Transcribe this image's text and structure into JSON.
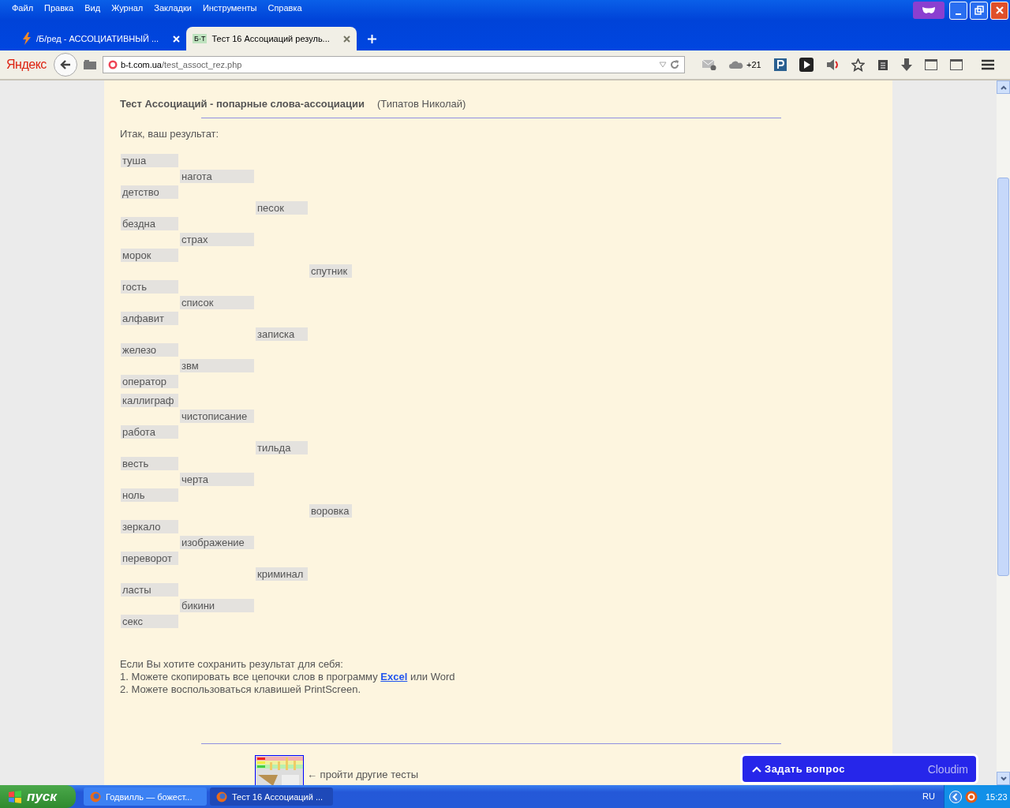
{
  "menu": [
    "Файл",
    "Правка",
    "Вид",
    "Журнал",
    "Закладки",
    "Инструменты",
    "Справка"
  ],
  "tabs": [
    {
      "title": "/Б/ред - АССОЦИАТИВНЫЙ ...",
      "selected": false
    },
    {
      "title": "Тест 16 Ассоциаций резуль...",
      "selected": true,
      "favicon_text": "Б·Т"
    }
  ],
  "navbar": {
    "logo": "Яндекс",
    "url_host": "b-t.com.ua",
    "url_path": "/test_assoct_rez.php",
    "cloud_count": "+21"
  },
  "page": {
    "title": "Тест Ассоциаций - попарные слова-ассоциации",
    "author": "(Типатов Николай)",
    "intro": "Итак, ваш результат:",
    "rows": [
      {
        "column_1": "туша"
      },
      {
        "column_2": "нагота"
      },
      {
        "column_1": "детство"
      },
      {
        "column_3": "песок"
      },
      {
        "column_1": "бездна"
      },
      {
        "column_2": "страх"
      },
      {
        "column_1": "морок"
      },
      {
        "column_4": "спутник"
      },
      {
        "column_1": "гость"
      },
      {
        "column_2": "список"
      },
      {
        "column_1": "алфавит"
      },
      {
        "column_3": "записка"
      },
      {
        "column_1": "железо"
      },
      {
        "column_2": "звм"
      },
      {
        "column_1": "оператор"
      },
      {
        "column_1": "каллиграф"
      },
      {
        "column_2": "чистописание"
      },
      {
        "column_1": "работа"
      },
      {
        "column_3": "тильда"
      },
      {
        "column_1": "весть"
      },
      {
        "column_2": "черта"
      },
      {
        "column_1": "ноль"
      },
      {
        "column_4": "воровка"
      },
      {
        "column_1": "зеркало"
      },
      {
        "column_2": "изображение"
      },
      {
        "column_1": "переворот"
      },
      {
        "column_3": "криминал"
      },
      {
        "column_1": "ласты"
      },
      {
        "column_2": "бикини"
      },
      {
        "column_1": "секс"
      }
    ],
    "save_heading": "Если Вы хотите сохранить результат для себя:",
    "save_line_1": {
      "before": "1. Можете скопировать все цепочки слов в программу ",
      "link": "Excel",
      "after": " или Word"
    },
    "save_line_2": "2. Можете воспользоваться клавишей PrintScreen.",
    "other_tests": "← пройти другие тесты"
  },
  "chat_widget": {
    "label": "Задать вопрос",
    "brand": "Cloudim"
  },
  "taskbar": {
    "start": "пуск",
    "tasks": [
      {
        "title": "Годвилль — божест...",
        "selected": false
      },
      {
        "title": "Тест 16 Ассоциаций ...",
        "selected": true
      }
    ],
    "language": "RU",
    "clock": "15:23"
  }
}
